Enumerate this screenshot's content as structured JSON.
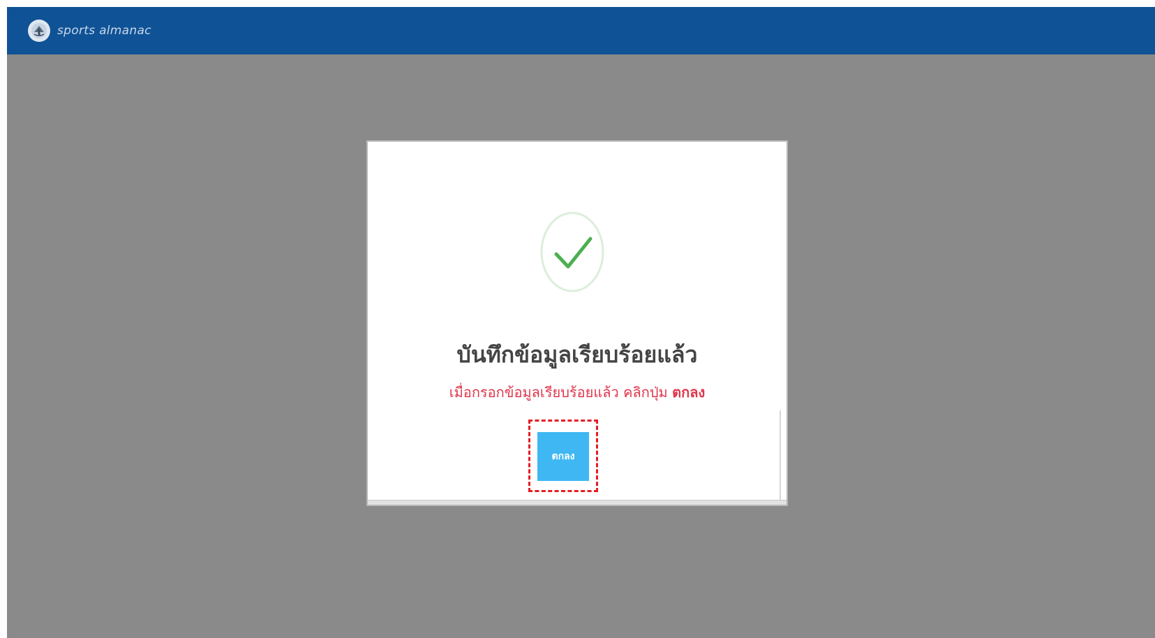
{
  "app": {
    "brand_name": "sports almanac",
    "logo_icon": "sports-almanac-logo-icon"
  },
  "dialog": {
    "icon": "success-check-icon",
    "title": "บันทึกข้อมูลเรียบร้อยแล้ว",
    "message_prefix": "เมื่อกรอกข้อมูลเรียบร้อยแล้ว คลิกปุ่ม ",
    "message_emphasis": "ตกลง",
    "ok_button_label": "ตกลง"
  },
  "colors": {
    "topbar": "#0f5296",
    "overlay": "#8a8a8a",
    "success": "#4caf50",
    "message": "#e0364c",
    "button": "#3fb7f3",
    "highlight": "#e31e24"
  }
}
